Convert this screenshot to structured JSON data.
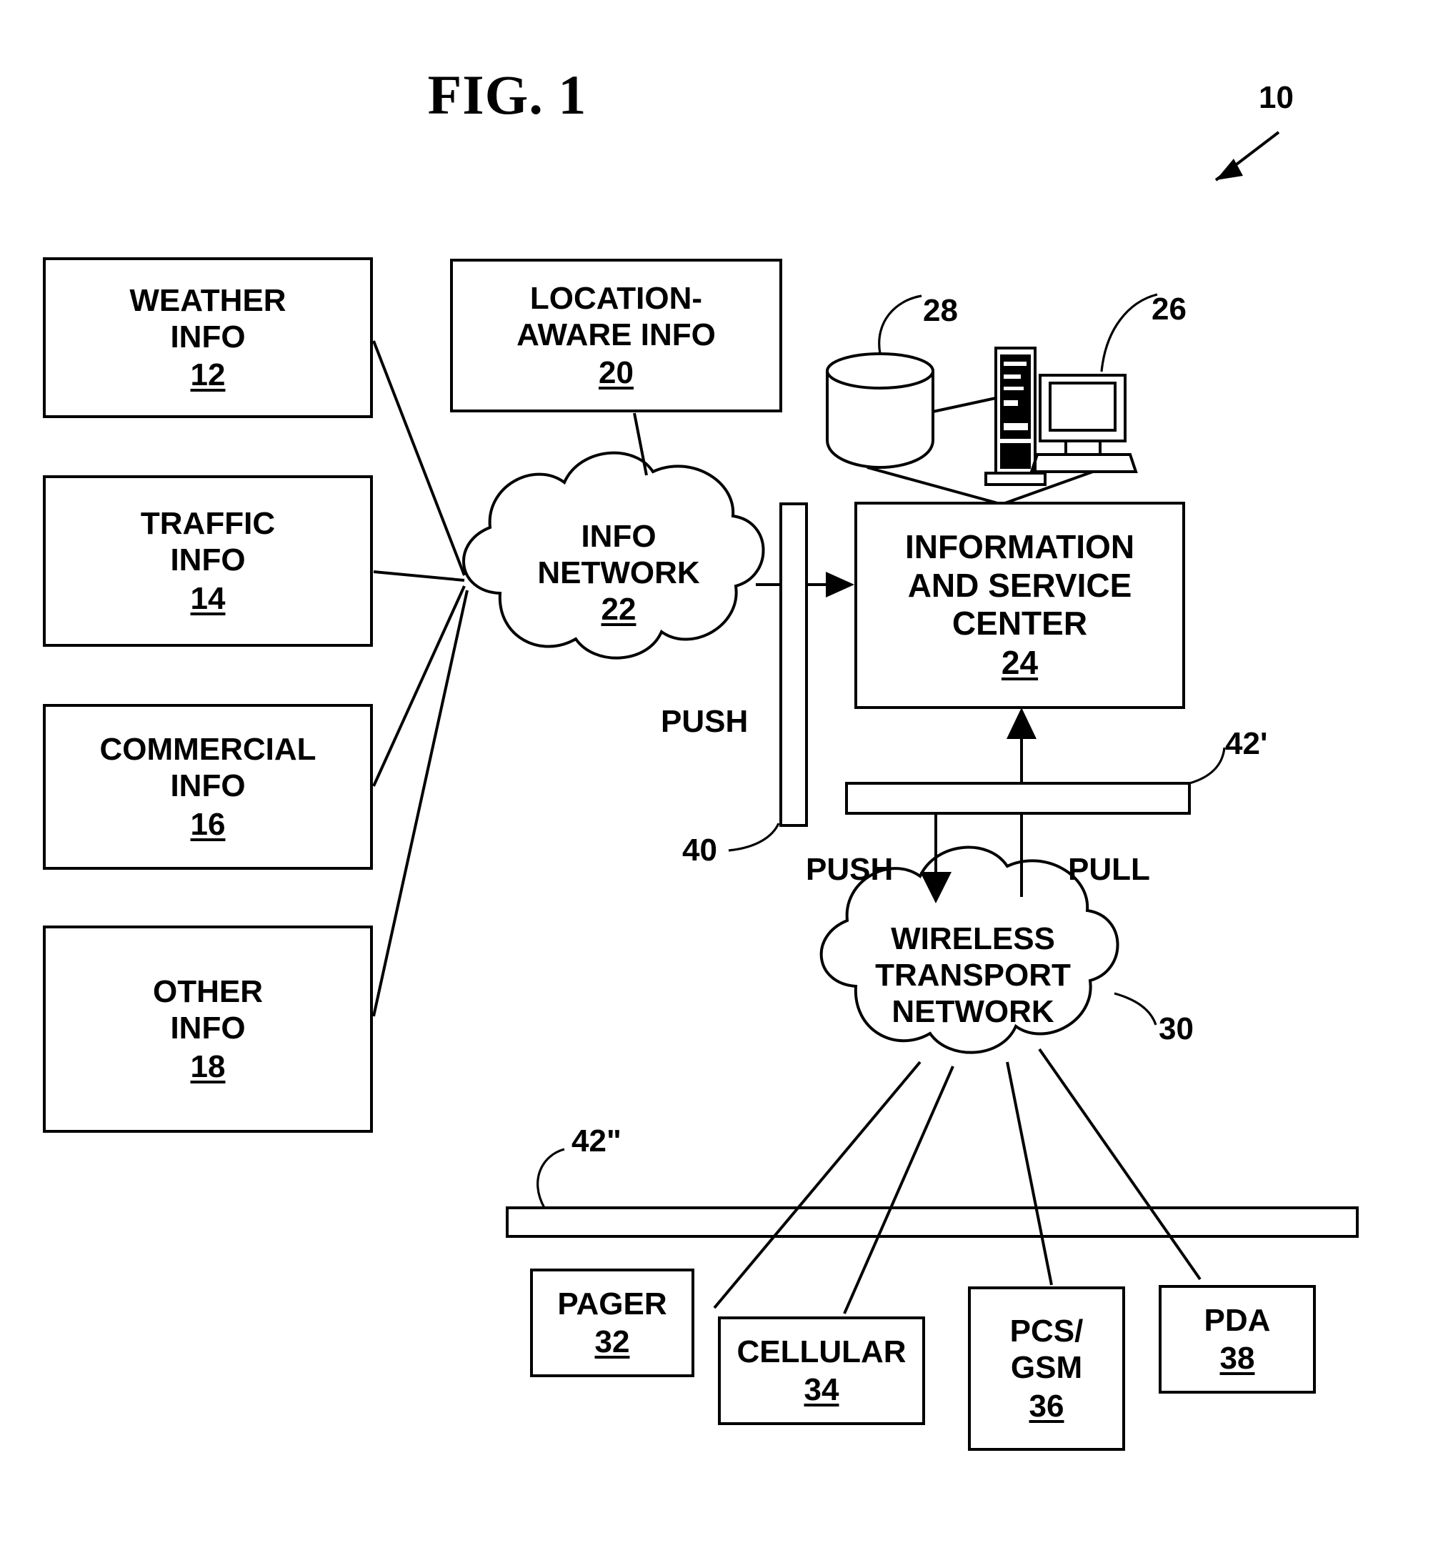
{
  "figure": {
    "title": "FIG. 1",
    "system_ref": "10"
  },
  "sources": [
    {
      "label": "WEATHER\nINFO",
      "num": "12"
    },
    {
      "label": "TRAFFIC\nINFO",
      "num": "14"
    },
    {
      "label": "COMMERCIAL\nINFO",
      "num": "16"
    },
    {
      "label": "OTHER\nINFO",
      "num": "18"
    }
  ],
  "location_box": {
    "label": "LOCATION-\nAWARE INFO",
    "num": "20"
  },
  "info_network": {
    "label": "INFO\nNETWORK",
    "num": "22"
  },
  "service_center": {
    "label": "INFORMATION\nAND SERVICE\nCENTER",
    "num": "24"
  },
  "wireless_network": {
    "label": "WIRELESS\nTRANSPORT\nNETWORK"
  },
  "icons": {
    "monitor_ref": "26",
    "database_ref": "28"
  },
  "refs": {
    "wireless_network_ref": "30",
    "push_bar_ref": "40",
    "bus_upper_ref": "42'",
    "bus_lower_ref": "42\""
  },
  "flow_labels": {
    "push_top": "PUSH",
    "push_bottom": "PUSH",
    "pull_bottom": "PULL"
  },
  "devices": [
    {
      "label": "PAGER",
      "num": "32"
    },
    {
      "label": "CELLULAR",
      "num": "34"
    },
    {
      "label": "PCS/\nGSM",
      "num": "36"
    },
    {
      "label": "PDA",
      "num": "38"
    }
  ],
  "colors": {
    "ink": "#000000",
    "paper": "#ffffff"
  }
}
